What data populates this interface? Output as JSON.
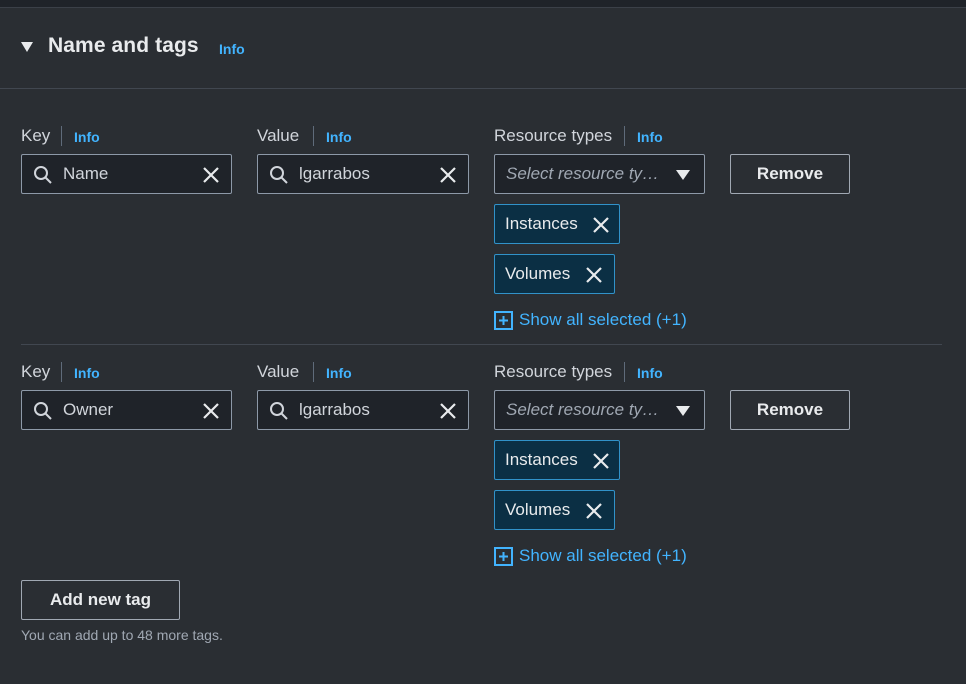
{
  "section": {
    "title": "Name and tags",
    "info": "Info"
  },
  "tags": [
    {
      "key_label": "Key",
      "key_info": "Info",
      "key_value": "Name",
      "value_label": "Value",
      "value_info": "Info",
      "value_value": "lgarrabos",
      "rt_label": "Resource types",
      "rt_info": "Info",
      "rt_placeholder": "Select resource ty…",
      "tokens": [
        "Instances",
        "Volumes"
      ],
      "show_all": "Show all selected (+1)",
      "remove_label": "Remove"
    },
    {
      "key_label": "Key",
      "key_info": "Info",
      "key_value": "Owner",
      "value_label": "Value",
      "value_info": "Info",
      "value_value": "lgarrabos",
      "rt_label": "Resource types",
      "rt_info": "Info",
      "rt_placeholder": "Select resource ty…",
      "tokens": [
        "Instances",
        "Volumes"
      ],
      "show_all": "Show all selected (+1)",
      "remove_label": "Remove"
    }
  ],
  "add_button": "Add new tag",
  "hint": "You can add up to 48 more tags.",
  "icons": {
    "caret": "caret-down-icon",
    "search": "search-icon",
    "clear": "close-icon",
    "dropdown": "triangle-down-icon",
    "expand": "plus-square-icon"
  },
  "colors": {
    "background": "#2a2e33",
    "link": "#42b4ff",
    "token_bg": "#0b2f44",
    "token_border": "#3192c9"
  }
}
